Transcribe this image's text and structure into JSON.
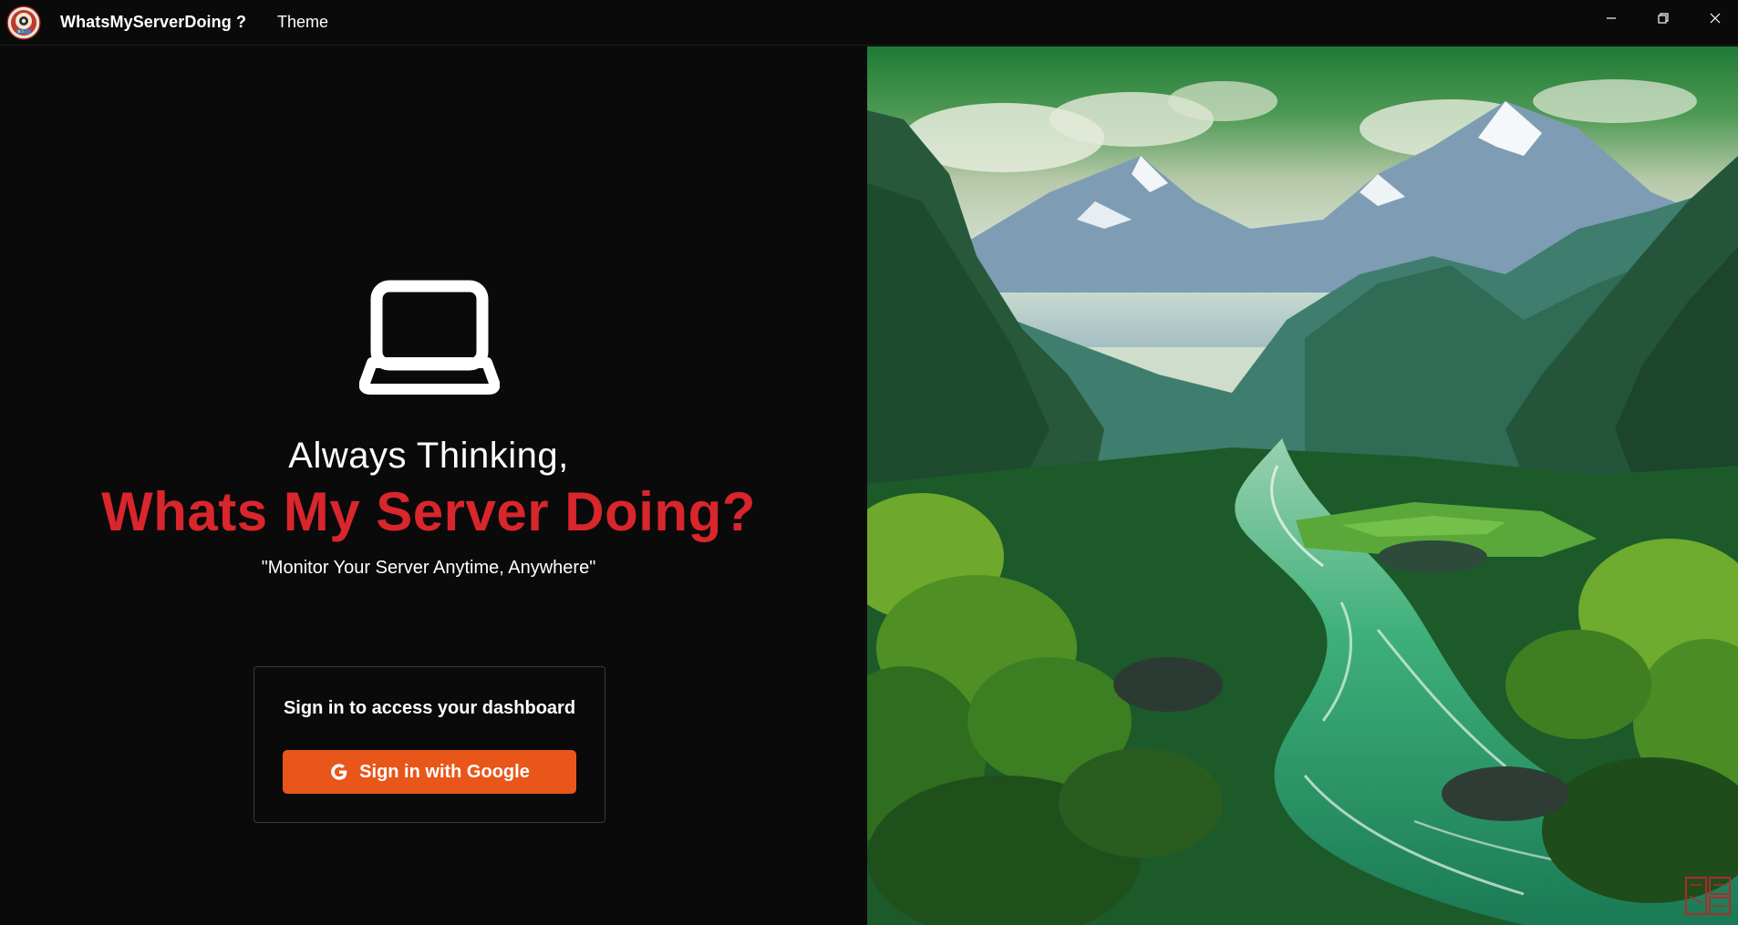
{
  "window": {
    "app_title": "WhatsMyServerDoing ?",
    "menu": {
      "theme_label": "Theme"
    },
    "controls": {
      "minimize_icon": "minimize-icon",
      "maximize_icon": "restore-icon",
      "close_icon": "close-icon"
    }
  },
  "hero": {
    "icon": "laptop-icon",
    "line1": "Always Thinking,",
    "line2": "Whats My Server Doing?",
    "tagline": "\"Monitor Your Server Anytime, Anywhere\""
  },
  "signin": {
    "title": "Sign in to access your dashboard",
    "button_label": "Sign in with Google",
    "button_icon": "google-icon"
  },
  "colors": {
    "background": "#0b0a0a",
    "headline_accent": "#d9262c",
    "button": "#e8561a",
    "card_border": "#3a3a3a"
  },
  "artwork": {
    "description_icon": "landscape-illustration",
    "seal_icon": "red-seal-stamp"
  }
}
